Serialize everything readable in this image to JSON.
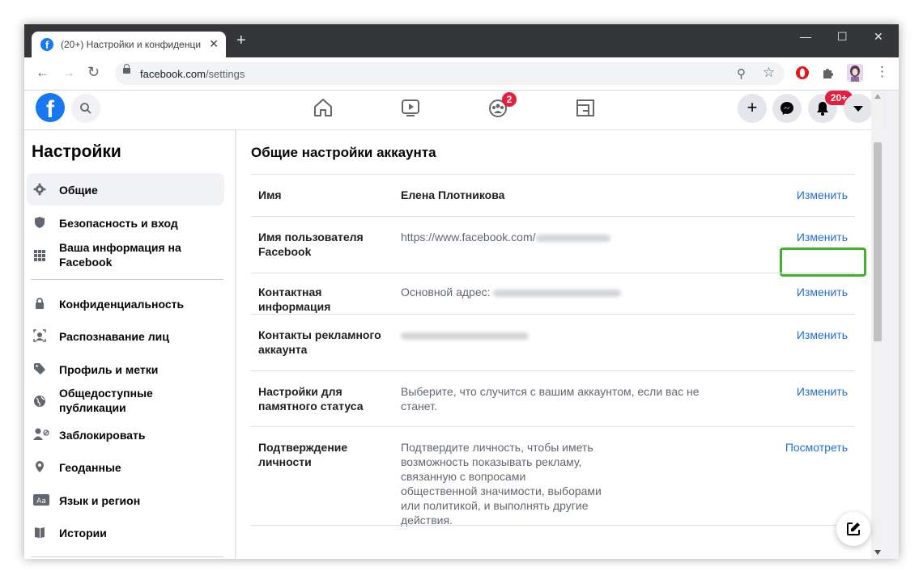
{
  "browser": {
    "tab_title": "(20+) Настройки и конфиденци",
    "favicon": "f",
    "tab_close": "✕",
    "new_tab": "+",
    "minimize": "—",
    "maximize": "☐",
    "close": "✕",
    "url_host": "facebook.com",
    "url_path": "/settings",
    "back": "←",
    "forward": "→",
    "reload": "↻",
    "zoom_icon": "⚲",
    "star_icon": "☆",
    "menu_icon": "⋮"
  },
  "fb_header": {
    "logo": "f",
    "groups_badge": "2",
    "notifications_badge": "20+",
    "plus_label": "+"
  },
  "sidebar": {
    "title": "Настройки",
    "items": [
      {
        "label": "Общие"
      },
      {
        "label": "Безопасность и вход"
      },
      {
        "label": "Ваша информация на Facebook"
      },
      {
        "label": "Конфиденциальность"
      },
      {
        "label": "Распознавание лиц"
      },
      {
        "label": "Профиль и метки"
      },
      {
        "label": "Общедоступные публикации"
      },
      {
        "label": "Заблокировать"
      },
      {
        "label": "Геоданные"
      },
      {
        "label": "Язык и регион"
      },
      {
        "label": "Истории"
      }
    ]
  },
  "main": {
    "title": "Общие настройки аккаунта",
    "rows": [
      {
        "label": "Имя",
        "value": "Елена Плотникова",
        "action": "Изменить"
      },
      {
        "label": "Имя пользователя Facebook",
        "value": "https://www.facebook.com/",
        "action": "Изменить"
      },
      {
        "label": "Контактная информация",
        "value": "Основной адрес:",
        "action": "Изменить"
      },
      {
        "label": "Контакты рекламного аккаунта",
        "value": "",
        "action": "Изменить"
      },
      {
        "label": "Настройки для памятного статуса",
        "value": "Выберите, что случится с вашим аккаунтом, если вас не станет.",
        "action": "Изменить"
      },
      {
        "label": "Подтверждение личности",
        "value": "Подтвердите личность, чтобы иметь возможность показывать рекламу, связанную с вопросами общественной значимости, выборами или политикой, и выполнять другие действия.",
        "action": "Посмотреть"
      }
    ]
  },
  "colors": {
    "fb_blue": "#1877f2",
    "link": "#216fdb",
    "badge_red": "#e41e3f",
    "highlight_green": "#43b02a"
  }
}
